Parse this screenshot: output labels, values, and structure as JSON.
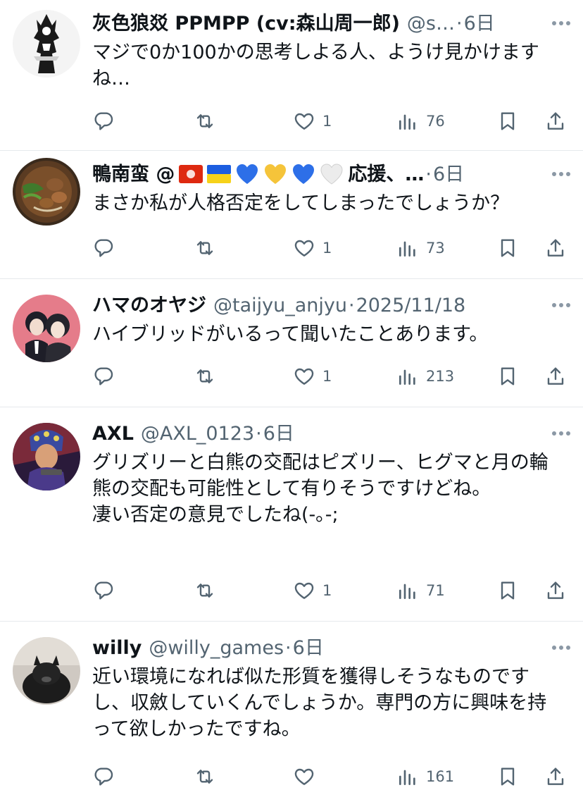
{
  "tweets": [
    {
      "display_name": "灰色狼㸚 PPMPP (cv:森山周一郎)",
      "handle": "@s…",
      "separator": "·",
      "time": "6日",
      "text": "マジで0か100かの思考しよる人、ようけ見かけますね…",
      "likes": "1",
      "views": "76",
      "avatar": "wolf-warrior-illustration"
    },
    {
      "display_name": "鴨南蛮 @",
      "display_name_suffix": "応援、…",
      "name_emojis": [
        "hong-kong-flag",
        "ukraine-flag",
        "blue-heart",
        "yellow-heart",
        "blue-heart",
        "white-heart"
      ],
      "separator": "·",
      "time": "6日",
      "text": "まさか私が人格否定をしてしまったでしょうか？",
      "likes": "1",
      "views": "73",
      "avatar": "duck-soba-bowl"
    },
    {
      "display_name": "ハマのオヤジ",
      "handle": "@taijyu_anjyu",
      "separator": "·",
      "time": "2025/11/18",
      "text": "ハイブリッドがいるって聞いたことあります。",
      "likes": "1",
      "views": "213",
      "avatar": "two-people-illustration"
    },
    {
      "display_name": "AXL",
      "handle": "@AXL_0123",
      "separator": "·",
      "time": "6日",
      "text": "グリズリーと白熊の交配はピズリー、ヒグマと月の輪熊の交配も可能性として有りそうですけどね。\n凄い否定の意見でしたね(-｡-;",
      "likes": "1",
      "views": "71",
      "avatar": "anime-character-with-gun"
    },
    {
      "display_name": "willy",
      "handle": "@willy_games",
      "separator": "·",
      "time": "6日",
      "text": "近い環境になれば似た形質を獲得しそうなものですし、収斂していくんでしょうか。専門の方に興味を持って欲しかったですね。",
      "likes": "",
      "views": "161",
      "avatar": "black-dog-photo"
    }
  ],
  "icons": {
    "reply": "reply-icon",
    "retweet": "retweet-icon",
    "like": "heart-icon",
    "views": "views-bar-chart-icon",
    "bookmark": "bookmark-icon",
    "share": "share-icon",
    "more": "more-dots-icon"
  },
  "colors": {
    "text_primary": "#0f1419",
    "text_secondary": "#536471",
    "divider": "#e6e9ec"
  }
}
